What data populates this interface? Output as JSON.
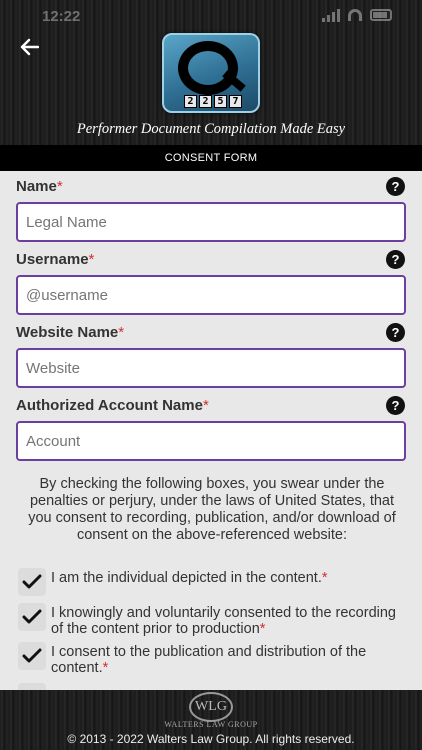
{
  "status_bar": {
    "time": "12:22"
  },
  "header": {
    "logo_letter": "Q",
    "logo_number": [
      "2",
      "2",
      "5",
      "7"
    ],
    "tagline": "Performer Document Compilation Made Easy"
  },
  "section": {
    "title": "CONSENT FORM"
  },
  "form": {
    "required_mark": "*",
    "help_symbol": "?",
    "fields": [
      {
        "label": "Name",
        "placeholder": "Legal Name"
      },
      {
        "label": "Username",
        "placeholder": "@username"
      },
      {
        "label": "Website Name",
        "placeholder": "Website"
      },
      {
        "label": "Authorized Account Name",
        "placeholder": "Account"
      }
    ],
    "disclaimer": "By checking the following boxes, you swear under the penalties or perjury, under the laws of United States, that you consent to recording, publication, and/or download of consent on the above-referenced website:",
    "checkboxes": [
      {
        "text": "I am the individual depicted in the content.",
        "checked": true
      },
      {
        "text": "I knowingly and voluntarily consented to the recording of the content prior to production",
        "checked": true
      },
      {
        "text": "I consent to the publication and distribution of the content.",
        "checked": true
      }
    ]
  },
  "footer": {
    "logo_initials": "WLG",
    "brand": "WALTERS LAW GROUP",
    "copyright": "© 2013 - 2022 Walters Law Group. All rights reserved."
  }
}
